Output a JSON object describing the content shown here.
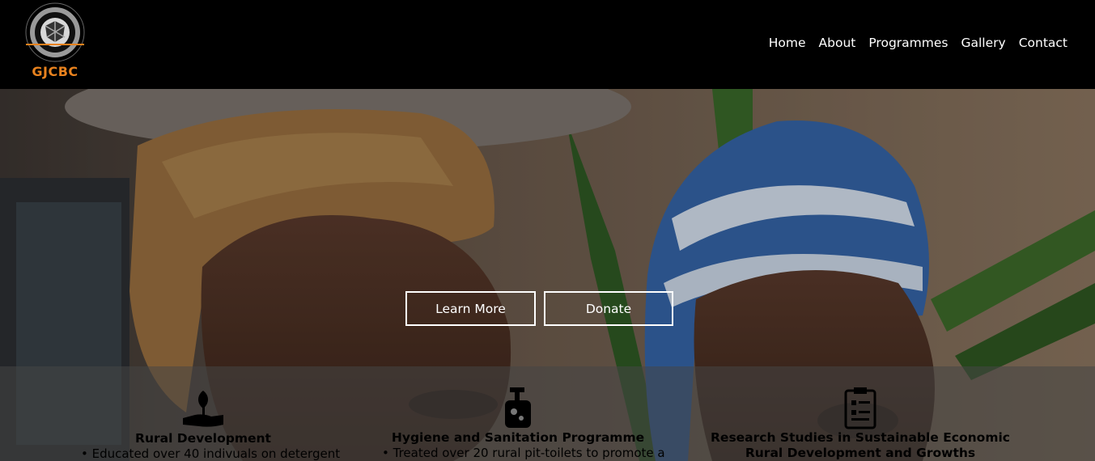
{
  "brand": {
    "name": "GJCBC",
    "ring_text": "GLOBAL JOINT COUNCIL OF BUSINESS COMMUNITIES",
    "accent": "#e8821e"
  },
  "nav": {
    "items": [
      {
        "label": "Home"
      },
      {
        "label": "About"
      },
      {
        "label": "Programmes"
      },
      {
        "label": "Gallery"
      },
      {
        "label": "Contact"
      }
    ]
  },
  "hero": {
    "learn_more": "Learn More",
    "donate": "Donate"
  },
  "features": [
    {
      "icon": "seedling-hand-icon",
      "title": "Rural Development",
      "text": "• Educated over 40 indivuals on detergent"
    },
    {
      "icon": "soap-dispenser-icon",
      "title": "Hygiene and Sanitation Programme",
      "text": "• Treated over 20 rural pit-toilets to promote a"
    },
    {
      "icon": "clipboard-icon",
      "title": "Research Studies in Sustainable Economic Rural Development and Growths",
      "text": ""
    }
  ]
}
